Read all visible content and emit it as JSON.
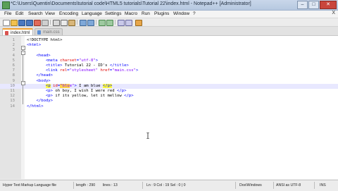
{
  "window": {
    "title": "*C:\\Users\\Quentin\\Documents\\tutorial code\\HTML5 tutorials\\Tutorial 22\\index.html - Notepad++ [Administrator]",
    "min_label": "–",
    "max_label": "□",
    "close_label": "✕"
  },
  "menu": {
    "items": [
      "File",
      "Edit",
      "Search",
      "View",
      "Encoding",
      "Language",
      "Settings",
      "Macro",
      "Run",
      "Plugins",
      "Window",
      "?"
    ],
    "close_label": "X"
  },
  "tabs": [
    {
      "label": "index.html",
      "active": true
    },
    {
      "label": "main.css",
      "active": false
    }
  ],
  "editor": {
    "lines": [
      {
        "n": "1",
        "tokens": [
          {
            "t": "<!DOCTYPE html>",
            "c": "doc"
          }
        ]
      },
      {
        "n": "2",
        "tokens": [
          {
            "t": "<html>",
            "c": "tag"
          }
        ]
      },
      {
        "n": "3",
        "tokens": []
      },
      {
        "n": "4",
        "tokens": [
          {
            "t": "    <head>",
            "c": "tag"
          }
        ]
      },
      {
        "n": "5",
        "tokens": [
          {
            "t": "        <meta ",
            "c": "tag"
          },
          {
            "t": "charset",
            "c": "attr"
          },
          {
            "t": "=",
            "c": "tag"
          },
          {
            "t": "\"utf-8\"",
            "c": "val"
          },
          {
            "t": ">",
            "c": "tag"
          }
        ]
      },
      {
        "n": "6",
        "tokens": [
          {
            "t": "        <title>",
            "c": "tag"
          },
          {
            "t": " Tutorial 22 - ID's ",
            "c": "text"
          },
          {
            "t": "</title>",
            "c": "tag"
          }
        ]
      },
      {
        "n": "7",
        "tokens": [
          {
            "t": "        <link ",
            "c": "tag"
          },
          {
            "t": "rel",
            "c": "attr"
          },
          {
            "t": "=",
            "c": "tag"
          },
          {
            "t": "\"stylesheet\"",
            "c": "val"
          },
          {
            "t": " ",
            "c": "tag"
          },
          {
            "t": "href",
            "c": "attr"
          },
          {
            "t": "=",
            "c": "tag"
          },
          {
            "t": "\"main.css\"",
            "c": "val"
          },
          {
            "t": ">",
            "c": "tag"
          }
        ]
      },
      {
        "n": "8",
        "tokens": [
          {
            "t": "    </head>",
            "c": "tag"
          }
        ]
      },
      {
        "n": "9",
        "tokens": [
          {
            "t": "    <body>",
            "c": "tag"
          }
        ]
      },
      {
        "n": "10",
        "current": true,
        "tokens": [
          {
            "t": "        ",
            "c": "tag"
          },
          {
            "t": "<p",
            "c": "tag",
            "hl": "tag"
          },
          {
            "t": " ",
            "c": "tag"
          },
          {
            "t": "id",
            "c": "attr"
          },
          {
            "t": "=",
            "c": "tag"
          },
          {
            "t": "\"blu",
            "c": "val",
            "hl": "val"
          },
          {
            "t": "e\"",
            "c": "val"
          },
          {
            "t": ">",
            "c": "tag"
          },
          {
            "t": " I am blue ",
            "c": "text"
          },
          {
            "t": "</p>",
            "c": "tag",
            "hl": "tag"
          }
        ]
      },
      {
        "n": "11",
        "tokens": [
          {
            "t": "        <p>",
            "c": "tag"
          },
          {
            "t": " oh boy, I wish I were red ",
            "c": "text"
          },
          {
            "t": "</p>",
            "c": "tag"
          }
        ]
      },
      {
        "n": "12",
        "tokens": [
          {
            "t": "        <p>",
            "c": "tag"
          },
          {
            "t": " if its yellow, let it mellow ",
            "c": "text"
          },
          {
            "t": "</p>",
            "c": "tag"
          }
        ]
      },
      {
        "n": "13",
        "tokens": [
          {
            "t": "    </body>",
            "c": "tag"
          }
        ]
      },
      {
        "n": "14",
        "tokens": [
          {
            "t": "</html>",
            "c": "tag"
          }
        ]
      }
    ]
  },
  "status": {
    "file_type": "Hyper Text Markup Language file",
    "length": "length : 290",
    "lines": "lines : 13",
    "position": "Ln : 9    Col : 19    Sel : 0 | 0",
    "eol": "Dos\\Windows",
    "encoding": "ANSI as UTF-8",
    "mode": "INS"
  },
  "colors": {
    "tag": "#0000ff",
    "attr": "#e00000",
    "value": "#8000ff",
    "current_line": "#e8e8ff",
    "tab_accent": "#f0a030"
  },
  "icons": [
    "app-icon",
    "new-file-icon",
    "open-icon",
    "save-icon",
    "save-all-icon",
    "close-file-icon",
    "print-icon",
    "cut-icon",
    "copy-icon",
    "paste-icon",
    "undo-icon",
    "redo-icon",
    "find-icon",
    "replace-icon",
    "zoom-in-icon",
    "zoom-out-icon",
    "run-icon"
  ]
}
